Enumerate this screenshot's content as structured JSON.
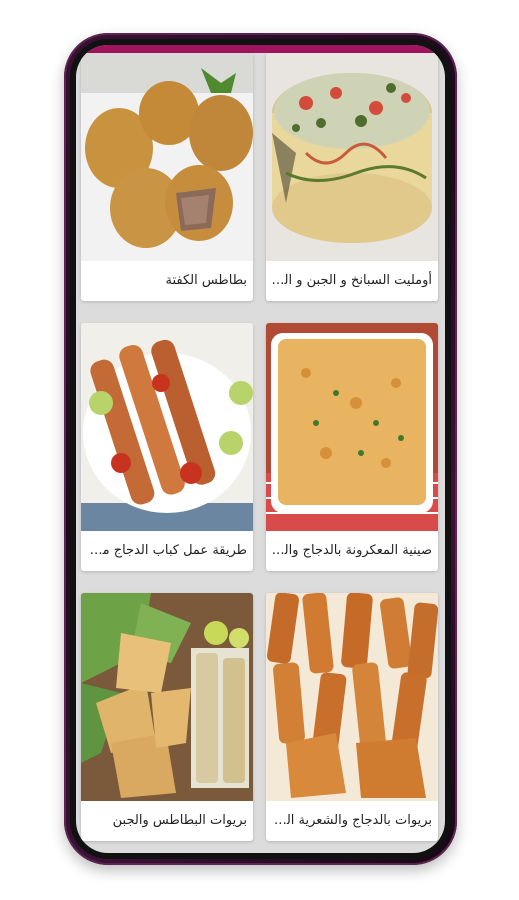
{
  "recipes": [
    {
      "title": "أومليت السبانخ و الجبن و الطماطم",
      "image": "spinach-cheese-tomato-omelette"
    },
    {
      "title": "بطاطس الكفتة",
      "image": "kofta-potato-croquettes"
    },
    {
      "title": "صينية المعكرونة بالدجاج والبشام...",
      "image": "chicken-bechamel-pasta-tray"
    },
    {
      "title": "طريقة عمل كباب الدجاج مع الأرز...",
      "image": "chicken-kebab-skewers"
    },
    {
      "title": "بريوات بالدجاج والشعرية الصينية",
      "image": "chicken-noodle-briouats"
    },
    {
      "title": "بريوات البطاطس والجبن",
      "image": "potato-cheese-briouats"
    }
  ],
  "colors": {
    "accent": "#a0155d",
    "phone_body": "#2a0d27",
    "card_bg": "#ffffff",
    "screen_bg": "#dcdcdc"
  }
}
